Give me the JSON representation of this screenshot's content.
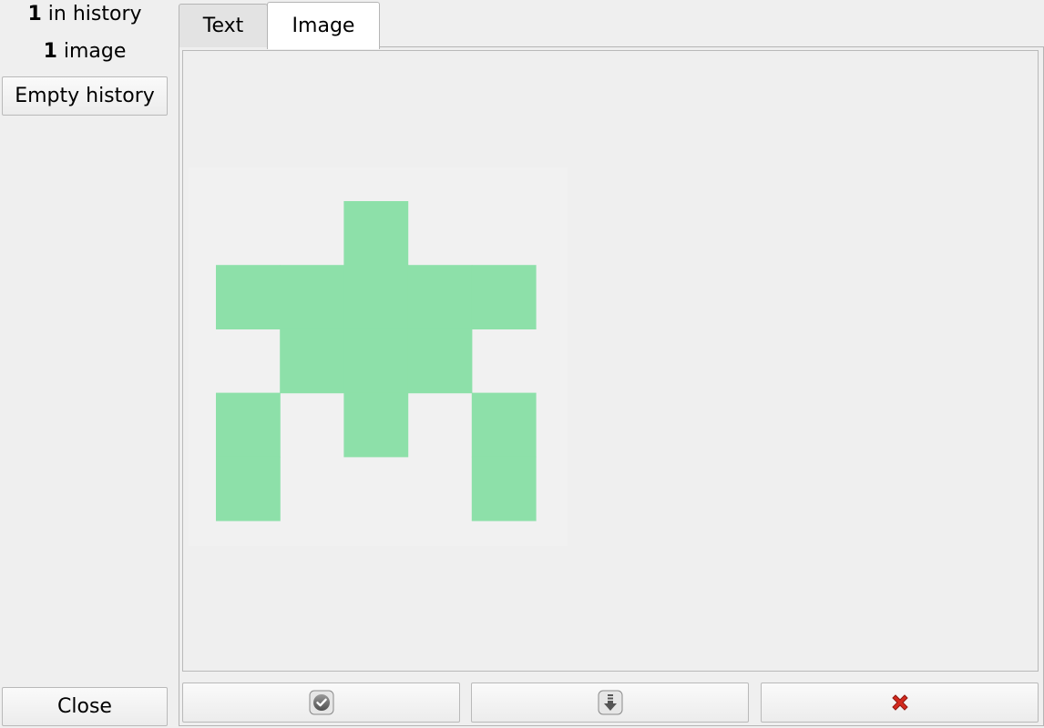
{
  "history": {
    "count": "1",
    "count_suffix": " in history",
    "images": "1",
    "images_suffix": " image",
    "empty_label": "Empty history",
    "close_label": "Close"
  },
  "tabs": [
    {
      "label": "Text",
      "selected": false
    },
    {
      "label": "Image",
      "selected": true
    }
  ],
  "preview": {
    "identicon_color": "#8de0a9",
    "identicon_background": "#f1f1f1",
    "pattern": [
      [
        0,
        0,
        1,
        0,
        0
      ],
      [
        1,
        1,
        1,
        1,
        1
      ],
      [
        0,
        1,
        1,
        1,
        0
      ],
      [
        1,
        0,
        1,
        0,
        1
      ],
      [
        1,
        0,
        0,
        0,
        1
      ]
    ]
  },
  "actions": [
    {
      "icon": "checkmark-icon"
    },
    {
      "icon": "download-icon"
    },
    {
      "icon": "delete-icon",
      "color": "#d42a1e"
    }
  ]
}
